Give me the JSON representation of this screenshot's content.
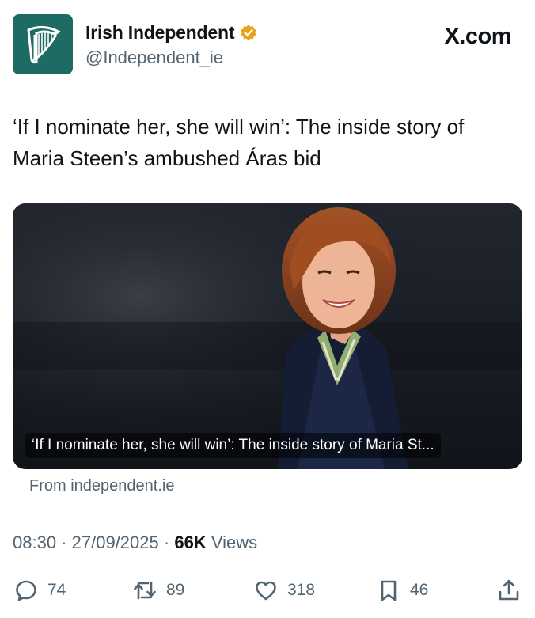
{
  "profile": {
    "display_name": "Irish Independent",
    "handle": "@Independent_ie",
    "avatar_icon": "harp-logo-icon",
    "verified_icon": "verified-badge-icon",
    "avatar_color": "#1e6b63"
  },
  "source_mark": "X.com",
  "tweet": {
    "text": "‘If I nominate her, she will win’: The inside story of Maria Steen’s ambushed Áras bid"
  },
  "card": {
    "caption": "‘If I nominate her, she will win’: The inside story of Maria St...",
    "domain": "From independent.ie"
  },
  "meta": {
    "time": "08:30",
    "separator": "·",
    "date": "27/09/2025",
    "views_count": "66K",
    "views_label": "Views"
  },
  "actions": {
    "replies": "74",
    "reposts": "89",
    "likes": "318",
    "bookmarks": "46",
    "icons": [
      "reply-icon",
      "repost-icon",
      "like-icon",
      "bookmark-icon",
      "share-icon"
    ]
  },
  "colors": {
    "text_primary": "#0f1419",
    "text_secondary": "#536471",
    "verified_gold": "#e8a317"
  }
}
